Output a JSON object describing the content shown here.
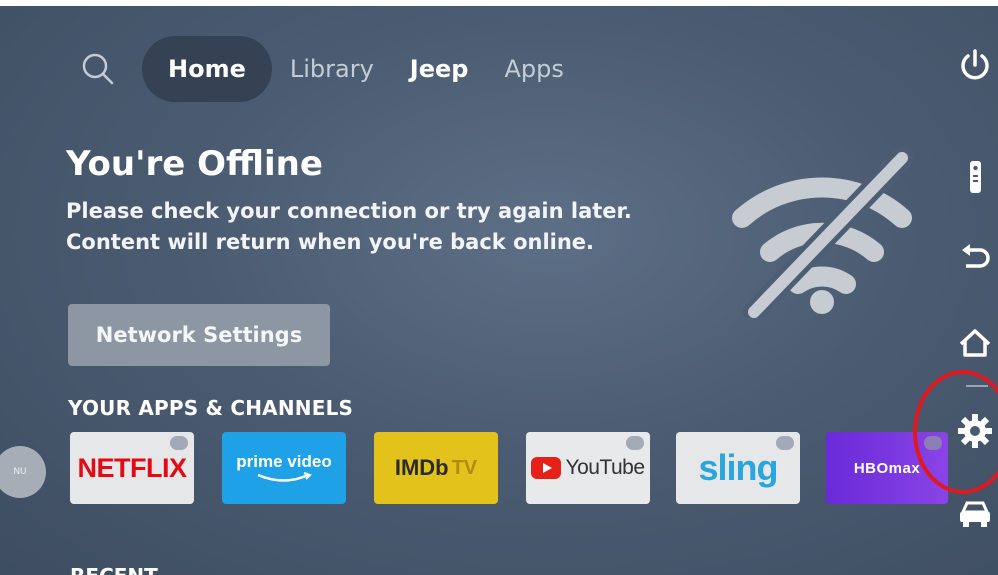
{
  "nav": {
    "tabs": [
      {
        "label": "Home"
      },
      {
        "label": "Library"
      },
      {
        "label": "Jeep"
      },
      {
        "label": "Apps"
      }
    ]
  },
  "offline": {
    "title": "You're Offline",
    "line1": "Please check your connection or try again later.",
    "line2": "Content will return when you're back online.",
    "button_label": "Network Settings"
  },
  "apps": {
    "section_title": "YOUR APPS & CHANNELS",
    "tiles": [
      {
        "name": "NETFLIX"
      },
      {
        "name": "prime video"
      },
      {
        "name": "IMDb",
        "suffix": "TV"
      },
      {
        "name": "YouTube"
      },
      {
        "name": "sling"
      },
      {
        "name": "HBOmax"
      }
    ]
  },
  "recent": {
    "title": "RECENT"
  },
  "sidebar": {
    "icons": [
      "power-icon",
      "remote-icon",
      "back-icon",
      "home-icon",
      "settings-icon",
      "car-icon"
    ]
  },
  "colors": {
    "highlight": "#e0191f",
    "netflix": "#e50914",
    "prime": "#1ea1e6",
    "imdb": "#e3c21c",
    "sling": "#2aa6de",
    "hbomax": "#6a2ad8"
  }
}
